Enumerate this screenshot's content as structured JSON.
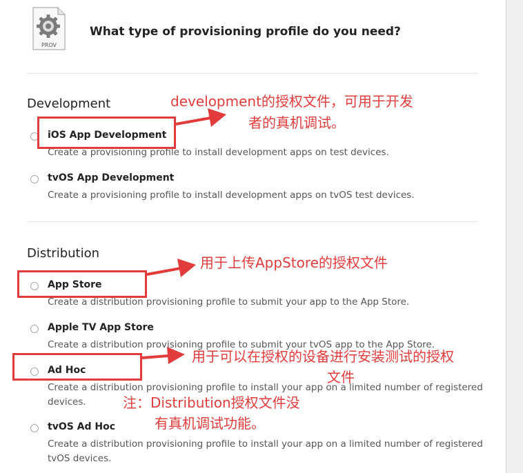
{
  "header": {
    "icon_label": "PROV",
    "title": "What type of provisioning profile do you need?"
  },
  "sections": {
    "development": {
      "heading": "Development",
      "options": [
        {
          "title": "iOS App Development",
          "desc": "Create a provisioning profile to install development apps on test devices."
        },
        {
          "title": "tvOS App Development",
          "desc": "Create a provisioning profile to install development apps on tvOS test devices."
        }
      ]
    },
    "distribution": {
      "heading": "Distribution",
      "options": [
        {
          "title": "App Store",
          "desc": "Create a distribution provisioning profile to submit your app to the App Store."
        },
        {
          "title": "Apple TV App Store",
          "desc": "Create a distribution provisioning profile to submit your tvOS app to the App Store."
        },
        {
          "title": "Ad Hoc",
          "desc": "Create a distribution provisioning profile to install your app on a limited number of registered devices."
        },
        {
          "title": "tvOS Ad Hoc",
          "desc": "Create a distribution provisioning profile to install your app on a limited number of registered tvOS devices."
        }
      ]
    }
  },
  "annotations": {
    "dev_note_1": "development的授权文件，可用于开发",
    "dev_note_2": "者的真机调试。",
    "appstore_note": "用于上传AppStore的授权文件",
    "adhoc_note_1": "用于可以在授权的设备进行安装测试的授权",
    "adhoc_note_2": "文件",
    "dist_note_1": "注：Distribution授权文件没",
    "dist_note_2": "有真机调试功能。"
  },
  "colors": {
    "annotation": "#e23b3b",
    "text": "#222222"
  }
}
